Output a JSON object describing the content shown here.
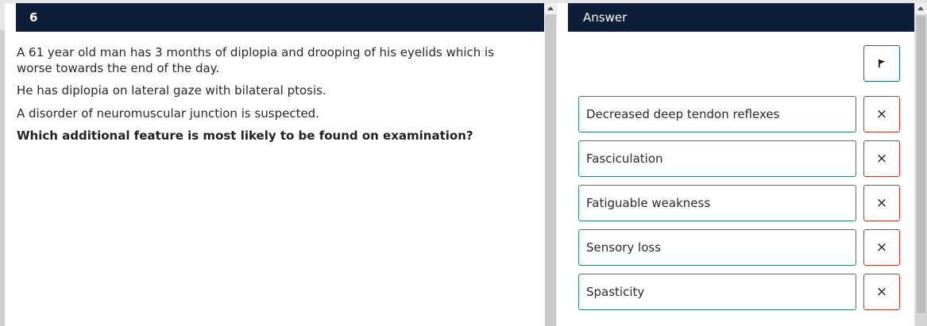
{
  "question": {
    "number": "6",
    "stem": [
      "A 61 year old man has 3 months of diplopia and drooping of his eyelids which is worse towards the end of the day.",
      "He has diplopia on lateral gaze with bilateral ptosis.",
      "A disorder of neuromuscular junction is suspected."
    ],
    "prompt": "Which additional feature is most likely to be found on examination?"
  },
  "answer": {
    "header": "Answer",
    "flag_icon": "flag-icon",
    "strike_icon": "×",
    "options": [
      "Decreased deep tendon reflexes",
      "Fasciculation",
      "Fatiguable weakness",
      "Sensory loss",
      "Spasticity"
    ]
  },
  "colors": {
    "header_bg": "#0e1e38",
    "option_border": "#2e8b6a",
    "strike_border": "#c0392b",
    "flag_border": "#1f6f8b"
  }
}
